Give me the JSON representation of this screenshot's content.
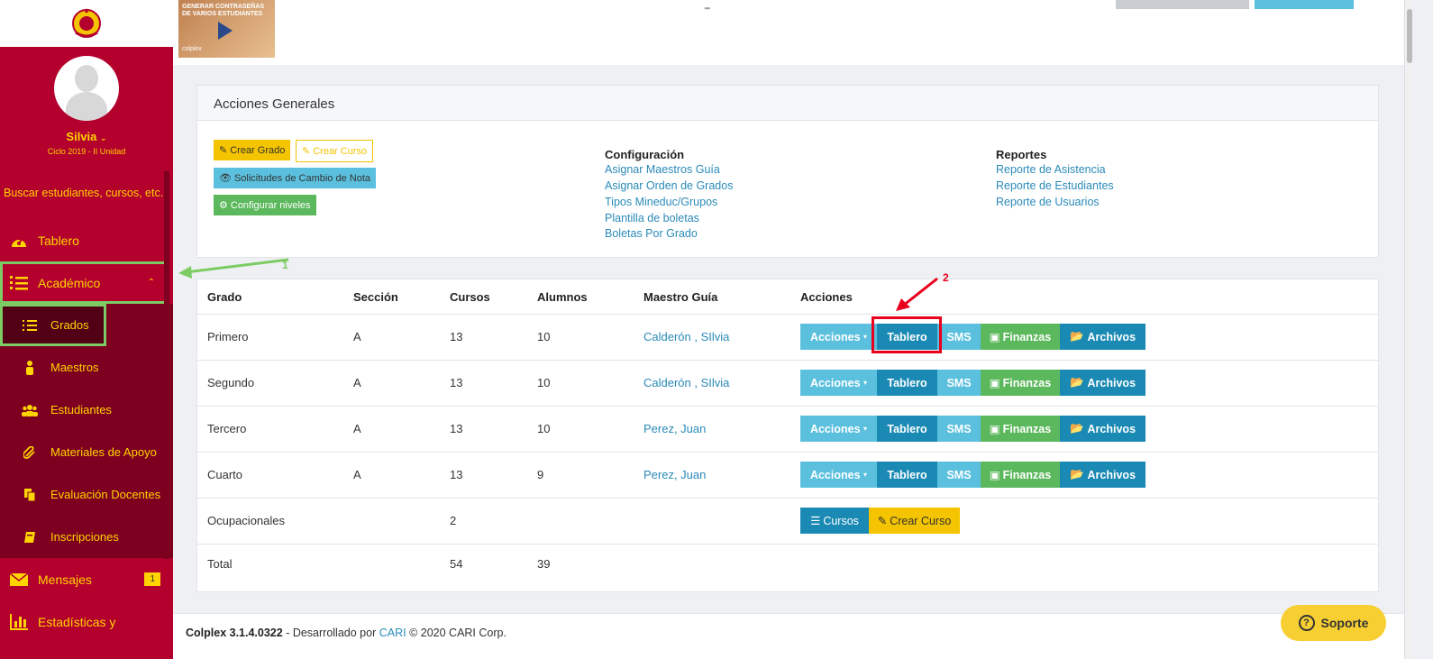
{
  "sidebar": {
    "user_name": "Silvia",
    "user_cycle": "Ciclo 2019 - II Unidad",
    "search_text": "Buscar estudiantes, cursos, etc...",
    "nav": {
      "tablero": "Tablero",
      "academico": "Académico",
      "mensajes": "Mensajes",
      "mensajes_badge": "1",
      "estadisticas": "Estadísticas y"
    },
    "submenu": {
      "grados": "Grados",
      "maestros": "Maestros",
      "estudiantes": "Estudiantes",
      "materiales": "Materiales de Apoyo",
      "evaluacion": "Evaluación Docentes",
      "inscripciones": "Inscripciones"
    }
  },
  "video": {
    "title": "GENERAR CONTRASEÑAS DE VARIOS ESTUDIANTES",
    "brand": "colplex"
  },
  "panel": {
    "title": "Acciones Generales",
    "buttons": {
      "crear_grado": "Crear Grado",
      "crear_curso": "Crear Curso",
      "solicitudes": "Solicitudes de Cambio de Nota",
      "configurar": "Configurar niveles"
    },
    "configuracion": {
      "title": "Configuración",
      "links": [
        "Asignar Maestros Guía",
        "Asignar Orden de Grados",
        "Tipos Mineduc/Grupos",
        "Plantilla de boletas",
        "Boletas Por Grado"
      ]
    },
    "reportes": {
      "title": "Reportes",
      "links": [
        "Reporte de Asistencia",
        "Reporte de Estudiantes",
        "Reporte de Usuarios"
      ]
    }
  },
  "table": {
    "headers": {
      "grado": "Grado",
      "seccion": "Sección",
      "cursos": "Cursos",
      "alumnos": "Alumnos",
      "maestro": "Maestro Guía",
      "acciones": "Acciones"
    },
    "action_labels": {
      "acciones": "Acciones",
      "tablero": "Tablero",
      "sms": "SMS",
      "finanzas": "Finanzas",
      "archivos": "Archivos",
      "cursos": "Cursos",
      "crear_curso": "Crear Curso"
    },
    "rows": [
      {
        "grado": "Primero",
        "seccion": "A",
        "cursos": "13",
        "alumnos": "10",
        "maestro": "Calderón , SIlvia"
      },
      {
        "grado": "Segundo",
        "seccion": "A",
        "cursos": "13",
        "alumnos": "10",
        "maestro": "Calderón , SIlvia"
      },
      {
        "grado": "Tercero",
        "seccion": "A",
        "cursos": "13",
        "alumnos": "10",
        "maestro": "Perez, Juan"
      },
      {
        "grado": "Cuarto",
        "seccion": "A",
        "cursos": "13",
        "alumnos": "9",
        "maestro": "Perez, Juan"
      }
    ],
    "ocupacionales": {
      "grado": "Ocupacionales",
      "cursos": "2"
    },
    "total": {
      "grado": "Total",
      "cursos": "54",
      "alumnos": "39"
    }
  },
  "annotations": {
    "one": "1",
    "two": "2"
  },
  "footer": {
    "product": "Colplex 3.1.4.0322",
    "dev_text": "- Desarrollado por",
    "cari": "CARI",
    "copyright": "© 2020 CARI Corp."
  },
  "support": {
    "label": "Soporte"
  },
  "colors": {
    "sidebar": "#b3002d",
    "accent_yellow": "#ffd400",
    "info": "#5bc0de",
    "primary": "#1a8ab4",
    "success": "#5cb85c",
    "annot_green": "#7ccc63",
    "annot_red": "#e8001c"
  }
}
